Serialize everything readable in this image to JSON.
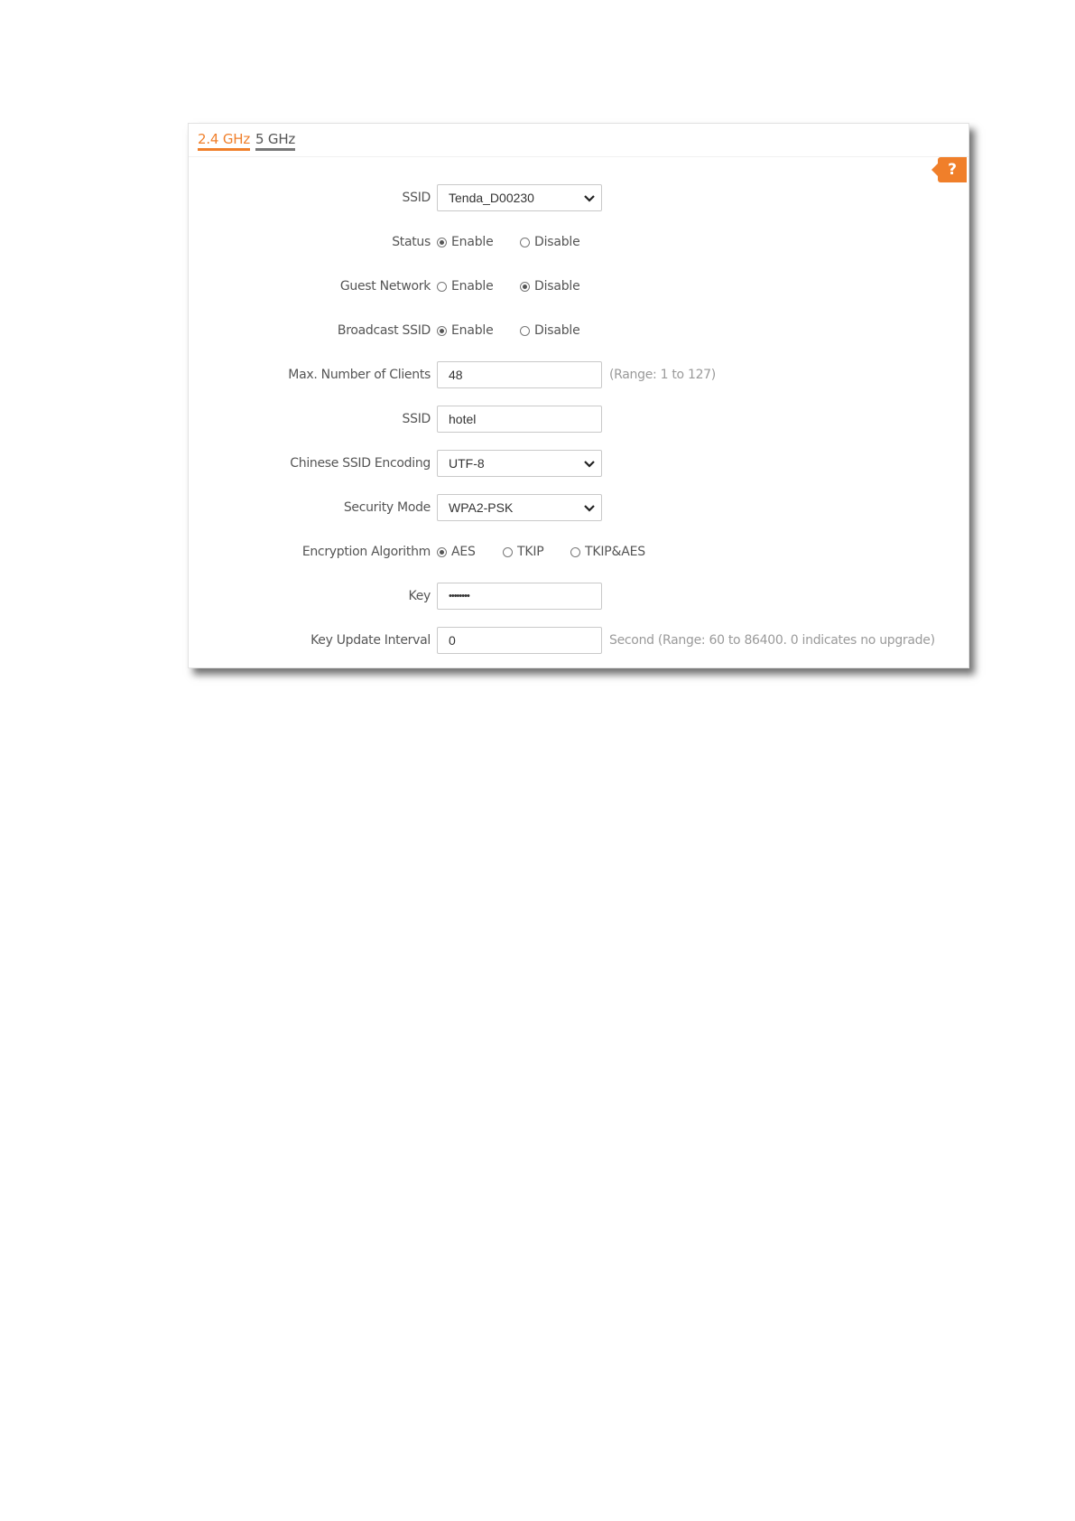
{
  "tabs": [
    {
      "label": "2.4 GHz",
      "active": true
    },
    {
      "label": "5 GHz",
      "active": false
    }
  ],
  "help": {
    "label": "?"
  },
  "form": {
    "ssid_select": {
      "label": "SSID",
      "value": "Tenda_D00230"
    },
    "status": {
      "label": "Status",
      "options": [
        "Enable",
        "Disable"
      ],
      "selected": "Enable"
    },
    "guest_network": {
      "label": "Guest Network",
      "options": [
        "Enable",
        "Disable"
      ],
      "selected": "Disable"
    },
    "broadcast_ssid": {
      "label": "Broadcast SSID",
      "options": [
        "Enable",
        "Disable"
      ],
      "selected": "Enable"
    },
    "max_clients": {
      "label": "Max. Number of Clients",
      "value": "48",
      "hint": "(Range: 1 to 127)"
    },
    "ssid_input": {
      "label": "SSID",
      "value": "hotel"
    },
    "chinese_encoding": {
      "label": "Chinese SSID Encoding",
      "value": "UTF-8"
    },
    "security_mode": {
      "label": "Security Mode",
      "value": "WPA2-PSK"
    },
    "encryption": {
      "label": "Encryption Algorithm",
      "options": [
        "AES",
        "TKIP",
        "TKIP&AES"
      ],
      "selected": "AES"
    },
    "key": {
      "label": "Key",
      "value": "••••••••"
    },
    "key_update": {
      "label": "Key Update Interval",
      "value": "0",
      "hint": "Second (Range: 60 to 86400. 0 indicates no upgrade)"
    }
  },
  "colors": {
    "accent": "#f07f2a",
    "text": "#555555",
    "hint": "#9a9a9a"
  }
}
